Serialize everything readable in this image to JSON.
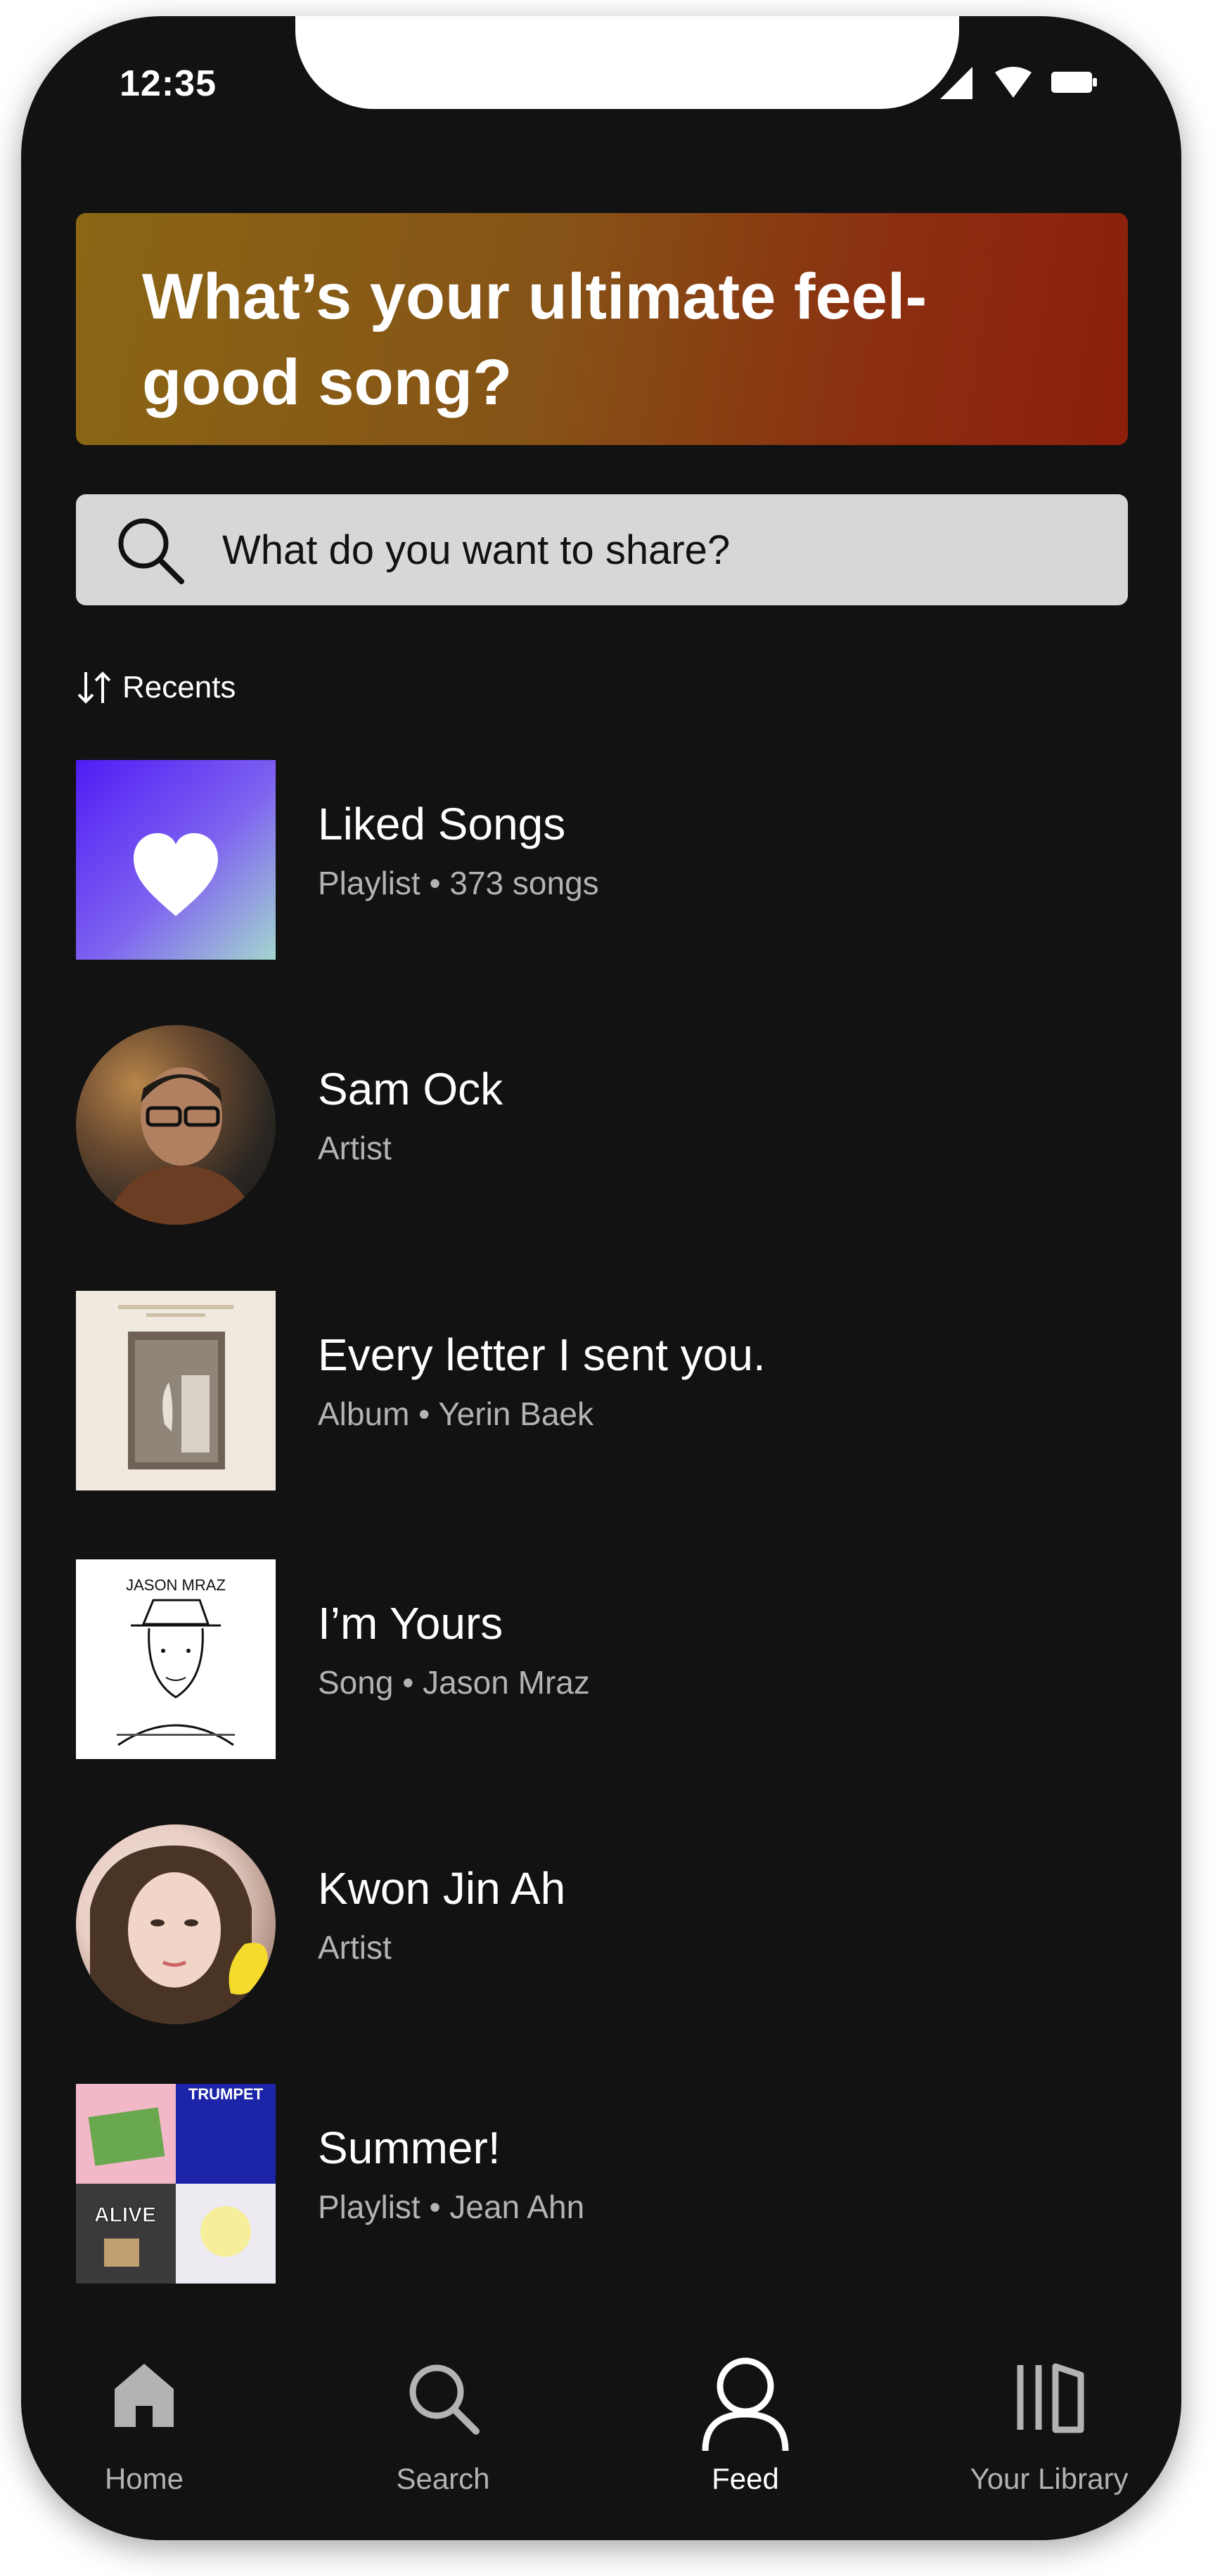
{
  "status_bar": {
    "time": "12:35",
    "icons": [
      "signal-icon",
      "wifi-icon",
      "battery-icon"
    ]
  },
  "banner": {
    "title": "What’s your ultimate feel-good song?",
    "gradient": [
      "#8a6615",
      "#8c1f0a"
    ]
  },
  "search": {
    "placeholder": "What do you want to share?",
    "icon": "search-icon"
  },
  "sort": {
    "label": "Recents",
    "icon": "sort-arrows-icon"
  },
  "items": [
    {
      "title": "Liked Songs",
      "subtitle": "Playlist • 373 songs",
      "artwork": "heart-gradient",
      "shape": "square"
    },
    {
      "title": "Sam Ock",
      "subtitle": "Artist",
      "artwork": "artist-photo",
      "shape": "round"
    },
    {
      "title": "Every letter I sent you.",
      "subtitle": "Album • Yerin Baek",
      "artwork": "album-cover",
      "shape": "square"
    },
    {
      "title": "I’m Yours",
      "subtitle": "Song • Jason Mraz",
      "artwork": "song-cover",
      "shape": "square",
      "cover_text": "JASON MRAZ"
    },
    {
      "title": "Kwon Jin Ah",
      "subtitle": "Artist",
      "artwork": "artist-photo",
      "shape": "round"
    },
    {
      "title": "Summer!",
      "subtitle": "Playlist • Jean Ahn",
      "artwork": "mosaic",
      "shape": "square",
      "cover_text": [
        "TRUMPET",
        "ALIVE"
      ]
    }
  ],
  "nav": [
    {
      "label": "Home",
      "icon": "home-icon",
      "active": false
    },
    {
      "label": "Search",
      "icon": "search-icon",
      "active": false
    },
    {
      "label": "Feed",
      "icon": "profile-icon",
      "active": true
    },
    {
      "label": "Your Library",
      "icon": "library-icon",
      "active": false
    }
  ],
  "colors": {
    "background": "#121212",
    "text": "#ffffff",
    "muted": "#b3b3b3",
    "search_bg": "#d7d7d7",
    "liked_gradient": [
      "#4f1cf5",
      "#a3d6cf"
    ]
  }
}
